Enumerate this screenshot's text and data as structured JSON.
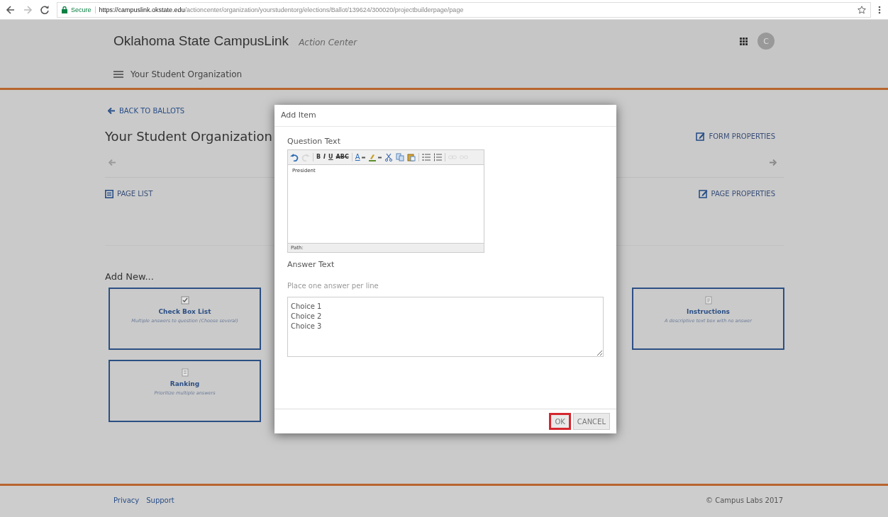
{
  "browser": {
    "secure_label": "Secure",
    "url_host": "https://campuslink.okstate.edu",
    "url_path": "/actioncenter/organization/yourstudentorg/elections/Ballot/139624/300020/projectbuilderpage/page"
  },
  "header": {
    "title": "Oklahoma State CampusLink",
    "subtitle": "Action Center",
    "avatar": "C",
    "nav_label": "Your Student Organization"
  },
  "page": {
    "back_link": "BACK TO BALLOTS",
    "title": "Your Student Organization",
    "form_properties": "FORM PROPERTIES",
    "page_list": "PAGE LIST",
    "page_properties": "PAGE PROPERTIES",
    "add_new": "Add New..."
  },
  "cards": [
    {
      "kind": "checkbox",
      "title": "Check Box List",
      "description": "Multiple answers to question (Choose several)"
    },
    {
      "kind": "instructions",
      "title": "Instructions",
      "description": "A descriptive text box with no answer"
    },
    {
      "kind": "ranking",
      "title": "Ranking",
      "description": "Prioritize multiple answers"
    }
  ],
  "dialog": {
    "title": "Add Item",
    "question_label": "Question Text",
    "toolbar": [
      {
        "kind": "undo",
        "disabled": false
      },
      {
        "kind": "redo",
        "disabled": true
      },
      {
        "kind": "sep"
      },
      {
        "kind": "bold",
        "label": "B",
        "disabled": false
      },
      {
        "kind": "italic",
        "label": "I",
        "disabled": false
      },
      {
        "kind": "underline",
        "label": "U",
        "disabled": false
      },
      {
        "kind": "strike",
        "label": "ABC",
        "disabled": false
      },
      {
        "kind": "sep"
      },
      {
        "kind": "forecolor",
        "label": "A",
        "disabled": false
      },
      {
        "kind": "highlight",
        "disabled": false
      },
      {
        "kind": "cut",
        "disabled": false
      },
      {
        "kind": "copy",
        "disabled": false
      },
      {
        "kind": "paste",
        "disabled": false
      },
      {
        "kind": "sep"
      },
      {
        "kind": "bullets",
        "disabled": false
      },
      {
        "kind": "numbers",
        "disabled": false
      },
      {
        "kind": "sep"
      },
      {
        "kind": "link",
        "disabled": true
      },
      {
        "kind": "unlink",
        "disabled": true
      }
    ],
    "question_value": "President",
    "path_label": "Path:",
    "answer_label": "Answer Text",
    "answer_hint": "Place one answer per line",
    "answers": [
      "Choice 1",
      "Choice 2",
      "Choice 3"
    ],
    "buttons": [
      {
        "label": "OK",
        "highlighted": true
      },
      {
        "label": "CANCEL",
        "highlighted": false
      }
    ]
  },
  "footer": {
    "links": [
      "Privacy",
      "Support"
    ],
    "copyright": "© Campus Labs 2017"
  }
}
